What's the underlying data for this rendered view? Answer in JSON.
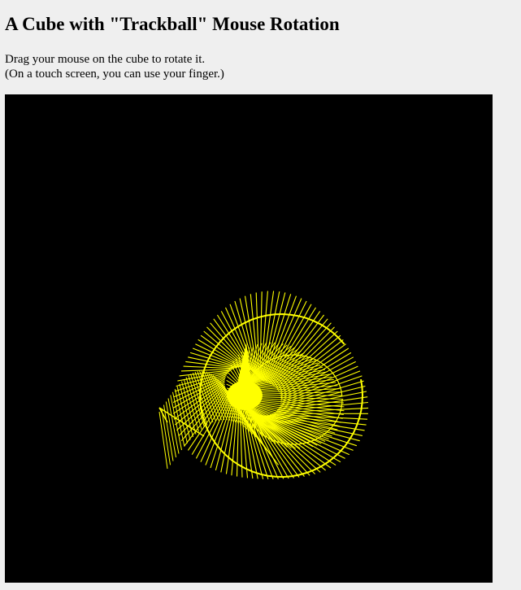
{
  "page": {
    "title": "A Cube with \"Trackball\" Mouse Rotation",
    "instruction_line1": "Drag your mouse on the cube to rotate it.",
    "instruction_line2": "(On a touch screen, you can use your finger.)"
  },
  "canvas": {
    "background_color": "#000000",
    "stroke_color": "#ffff00"
  }
}
